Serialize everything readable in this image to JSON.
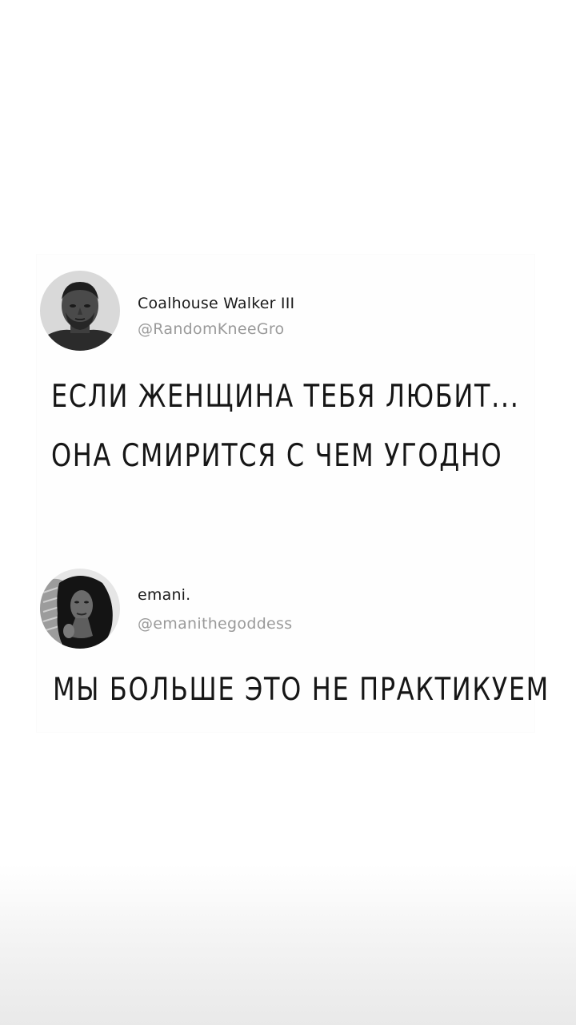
{
  "tweets": [
    {
      "author_name": "Coalhouse Walker III",
      "handle": "@RandomKneeGro",
      "avatar_icon": "man-portrait-avatar",
      "text_lines": [
        "ЕСЛИ ЖЕНЩИНА ТЕБЯ ЛЮБИТ...",
        "ОНА СМИРИТСЯ С ЧЕМ УГОДНО"
      ]
    },
    {
      "author_name": "emani.",
      "handle": "@emanithegoddess",
      "avatar_icon": "woman-portrait-avatar",
      "text_lines": [
        "МЫ БОЛЬШЕ ЭТО НЕ ПРАКТИКУЕМ"
      ]
    }
  ],
  "colors": {
    "background": "#ffffff",
    "card": "#fefefe",
    "name_text": "#1b1b1b",
    "handle_text": "#9a9a9a",
    "body_text": "#161616"
  }
}
